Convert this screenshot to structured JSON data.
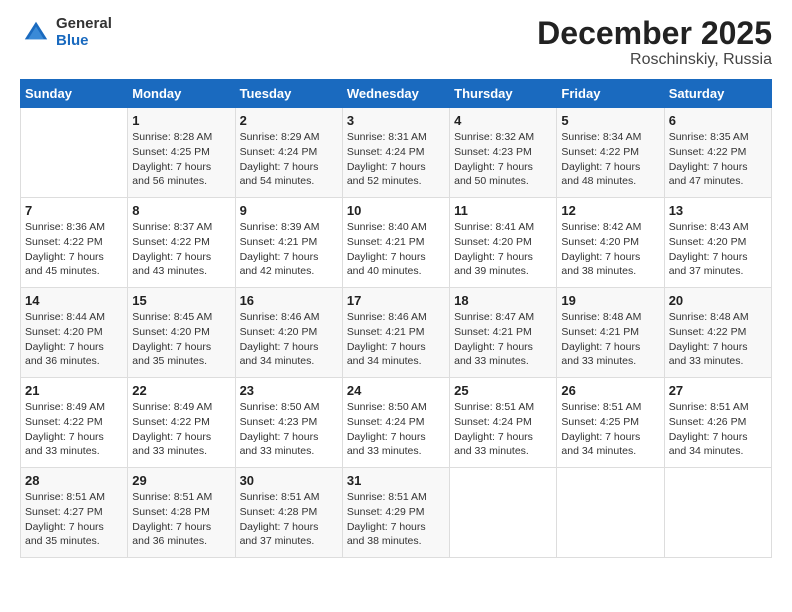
{
  "logo": {
    "general": "General",
    "blue": "Blue"
  },
  "title": "December 2025",
  "subtitle": "Roschinskiy, Russia",
  "days_of_week": [
    "Sunday",
    "Monday",
    "Tuesday",
    "Wednesday",
    "Thursday",
    "Friday",
    "Saturday"
  ],
  "weeks": [
    [
      {
        "day": "",
        "sunrise": "",
        "sunset": "",
        "daylight": ""
      },
      {
        "day": "1",
        "sunrise": "Sunrise: 8:28 AM",
        "sunset": "Sunset: 4:25 PM",
        "daylight": "Daylight: 7 hours and 56 minutes."
      },
      {
        "day": "2",
        "sunrise": "Sunrise: 8:29 AM",
        "sunset": "Sunset: 4:24 PM",
        "daylight": "Daylight: 7 hours and 54 minutes."
      },
      {
        "day": "3",
        "sunrise": "Sunrise: 8:31 AM",
        "sunset": "Sunset: 4:24 PM",
        "daylight": "Daylight: 7 hours and 52 minutes."
      },
      {
        "day": "4",
        "sunrise": "Sunrise: 8:32 AM",
        "sunset": "Sunset: 4:23 PM",
        "daylight": "Daylight: 7 hours and 50 minutes."
      },
      {
        "day": "5",
        "sunrise": "Sunrise: 8:34 AM",
        "sunset": "Sunset: 4:22 PM",
        "daylight": "Daylight: 7 hours and 48 minutes."
      },
      {
        "day": "6",
        "sunrise": "Sunrise: 8:35 AM",
        "sunset": "Sunset: 4:22 PM",
        "daylight": "Daylight: 7 hours and 47 minutes."
      }
    ],
    [
      {
        "day": "7",
        "sunrise": "Sunrise: 8:36 AM",
        "sunset": "Sunset: 4:22 PM",
        "daylight": "Daylight: 7 hours and 45 minutes."
      },
      {
        "day": "8",
        "sunrise": "Sunrise: 8:37 AM",
        "sunset": "Sunset: 4:22 PM",
        "daylight": "Daylight: 7 hours and 43 minutes."
      },
      {
        "day": "9",
        "sunrise": "Sunrise: 8:39 AM",
        "sunset": "Sunset: 4:21 PM",
        "daylight": "Daylight: 7 hours and 42 minutes."
      },
      {
        "day": "10",
        "sunrise": "Sunrise: 8:40 AM",
        "sunset": "Sunset: 4:21 PM",
        "daylight": "Daylight: 7 hours and 40 minutes."
      },
      {
        "day": "11",
        "sunrise": "Sunrise: 8:41 AM",
        "sunset": "Sunset: 4:20 PM",
        "daylight": "Daylight: 7 hours and 39 minutes."
      },
      {
        "day": "12",
        "sunrise": "Sunrise: 8:42 AM",
        "sunset": "Sunset: 4:20 PM",
        "daylight": "Daylight: 7 hours and 38 minutes."
      },
      {
        "day": "13",
        "sunrise": "Sunrise: 8:43 AM",
        "sunset": "Sunset: 4:20 PM",
        "daylight": "Daylight: 7 hours and 37 minutes."
      }
    ],
    [
      {
        "day": "14",
        "sunrise": "Sunrise: 8:44 AM",
        "sunset": "Sunset: 4:20 PM",
        "daylight": "Daylight: 7 hours and 36 minutes."
      },
      {
        "day": "15",
        "sunrise": "Sunrise: 8:45 AM",
        "sunset": "Sunset: 4:20 PM",
        "daylight": "Daylight: 7 hours and 35 minutes."
      },
      {
        "day": "16",
        "sunrise": "Sunrise: 8:46 AM",
        "sunset": "Sunset: 4:20 PM",
        "daylight": "Daylight: 7 hours and 34 minutes."
      },
      {
        "day": "17",
        "sunrise": "Sunrise: 8:46 AM",
        "sunset": "Sunset: 4:21 PM",
        "daylight": "Daylight: 7 hours and 34 minutes."
      },
      {
        "day": "18",
        "sunrise": "Sunrise: 8:47 AM",
        "sunset": "Sunset: 4:21 PM",
        "daylight": "Daylight: 7 hours and 33 minutes."
      },
      {
        "day": "19",
        "sunrise": "Sunrise: 8:48 AM",
        "sunset": "Sunset: 4:21 PM",
        "daylight": "Daylight: 7 hours and 33 minutes."
      },
      {
        "day": "20",
        "sunrise": "Sunrise: 8:48 AM",
        "sunset": "Sunset: 4:22 PM",
        "daylight": "Daylight: 7 hours and 33 minutes."
      }
    ],
    [
      {
        "day": "21",
        "sunrise": "Sunrise: 8:49 AM",
        "sunset": "Sunset: 4:22 PM",
        "daylight": "Daylight: 7 hours and 33 minutes."
      },
      {
        "day": "22",
        "sunrise": "Sunrise: 8:49 AM",
        "sunset": "Sunset: 4:22 PM",
        "daylight": "Daylight: 7 hours and 33 minutes."
      },
      {
        "day": "23",
        "sunrise": "Sunrise: 8:50 AM",
        "sunset": "Sunset: 4:23 PM",
        "daylight": "Daylight: 7 hours and 33 minutes."
      },
      {
        "day": "24",
        "sunrise": "Sunrise: 8:50 AM",
        "sunset": "Sunset: 4:24 PM",
        "daylight": "Daylight: 7 hours and 33 minutes."
      },
      {
        "day": "25",
        "sunrise": "Sunrise: 8:51 AM",
        "sunset": "Sunset: 4:24 PM",
        "daylight": "Daylight: 7 hours and 33 minutes."
      },
      {
        "day": "26",
        "sunrise": "Sunrise: 8:51 AM",
        "sunset": "Sunset: 4:25 PM",
        "daylight": "Daylight: 7 hours and 34 minutes."
      },
      {
        "day": "27",
        "sunrise": "Sunrise: 8:51 AM",
        "sunset": "Sunset: 4:26 PM",
        "daylight": "Daylight: 7 hours and 34 minutes."
      }
    ],
    [
      {
        "day": "28",
        "sunrise": "Sunrise: 8:51 AM",
        "sunset": "Sunset: 4:27 PM",
        "daylight": "Daylight: 7 hours and 35 minutes."
      },
      {
        "day": "29",
        "sunrise": "Sunrise: 8:51 AM",
        "sunset": "Sunset: 4:28 PM",
        "daylight": "Daylight: 7 hours and 36 minutes."
      },
      {
        "day": "30",
        "sunrise": "Sunrise: 8:51 AM",
        "sunset": "Sunset: 4:28 PM",
        "daylight": "Daylight: 7 hours and 37 minutes."
      },
      {
        "day": "31",
        "sunrise": "Sunrise: 8:51 AM",
        "sunset": "Sunset: 4:29 PM",
        "daylight": "Daylight: 7 hours and 38 minutes."
      },
      {
        "day": "",
        "sunrise": "",
        "sunset": "",
        "daylight": ""
      },
      {
        "day": "",
        "sunrise": "",
        "sunset": "",
        "daylight": ""
      },
      {
        "day": "",
        "sunrise": "",
        "sunset": "",
        "daylight": ""
      }
    ]
  ]
}
